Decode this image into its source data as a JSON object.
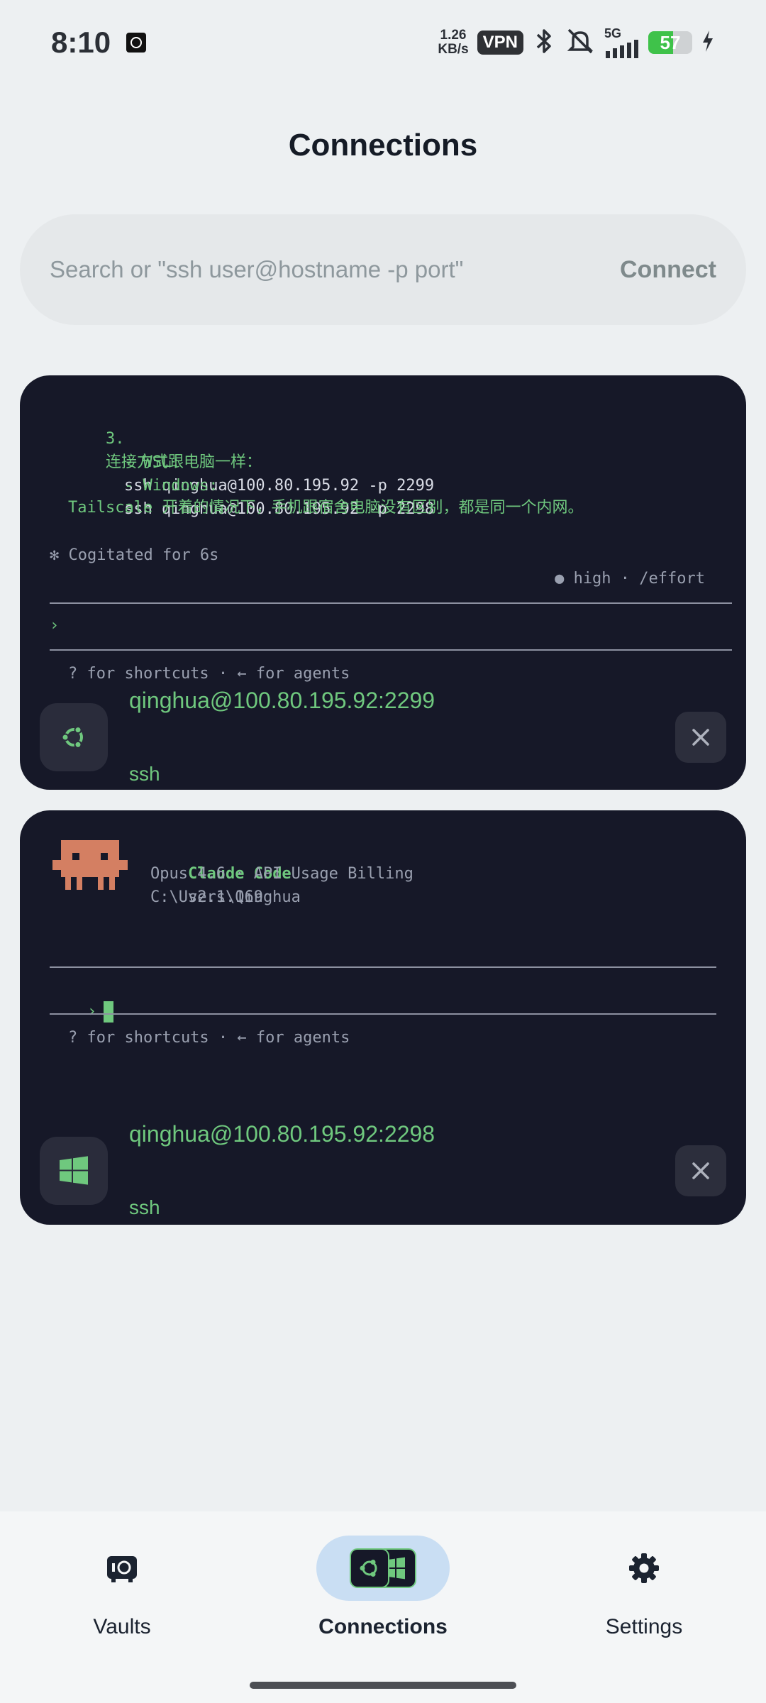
{
  "status_bar": {
    "time": "8:10",
    "net_speed_value": "1.26",
    "net_speed_unit": "KB/s",
    "vpn": "VPN",
    "network": "5G",
    "battery_level": "57",
    "battery_fraction": 0.57,
    "icons": [
      "app-icon",
      "bluetooth-icon",
      "bell-muted-icon",
      "signal-icon",
      "charging-icon"
    ]
  },
  "page": {
    "title": "Connections"
  },
  "search": {
    "placeholder": "Search or \"ssh user@hostname -p port\"",
    "value": "",
    "connect_label": "Connect"
  },
  "sessions": [
    {
      "terminal": {
        "line1_num": "3.",
        "line1_text": "连接方式跟电脑一样：",
        "line2_dash": "- WSL:",
        "line2_cmd": "ssh qinghua@100.80.195.92 -p 2299",
        "line3_dash": "- Windows:",
        "line3_cmd": "ssh qinghua@100.80.195.92 -p 2298",
        "line4": "Tailscale 开着的情况下，手机跟宿舍电脑没有区别，都是同一个内网。",
        "line5": "✻ Cogitated for 6s",
        "line6": "● high · /effort",
        "prompt": "›",
        "hint": "? for shortcuts · ← for agents"
      },
      "host": "qinghua@100.80.195.92:2299",
      "protocol": "ssh",
      "os_icon": "ubuntu-icon"
    },
    {
      "terminal": {
        "title": "Claude Code",
        "version": "v2.1.169",
        "model_line": "Opus 4.6 · API Usage Billing",
        "path_line": "C:\\Users\\Qinghua",
        "prompt": "›",
        "hint": "? for shortcuts · ← for agents"
      },
      "host": "qinghua@100.80.195.92:2298",
      "protocol": "ssh",
      "os_icon": "windows-icon"
    }
  ],
  "nav": {
    "vaults": "Vaults",
    "connections": "Connections",
    "settings": "Settings",
    "active": "connections"
  },
  "colors": {
    "background": "#edf0f2",
    "card": "#161828",
    "accent_green": "#6fc87e",
    "nav_active": "#c9def3",
    "claude_orange": "#d47f62"
  }
}
